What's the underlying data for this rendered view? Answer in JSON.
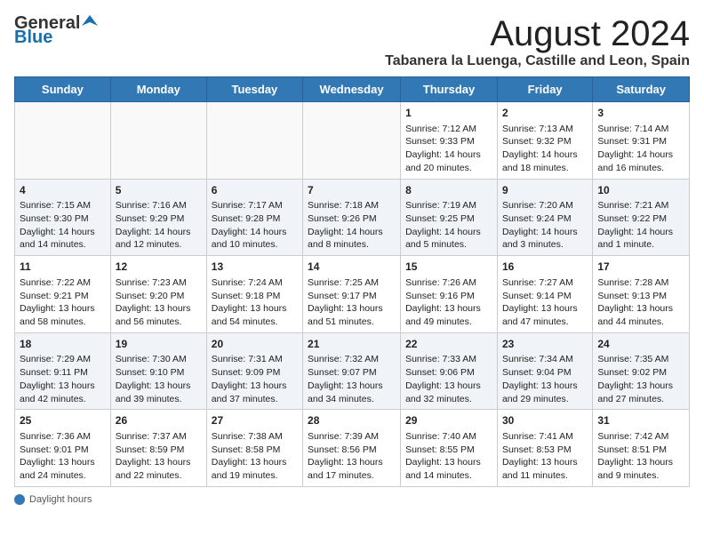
{
  "header": {
    "logo_general": "General",
    "logo_blue": "Blue",
    "title": "August 2024",
    "subtitle": "Tabanera la Luenga, Castille and Leon, Spain"
  },
  "weekdays": [
    "Sunday",
    "Monday",
    "Tuesday",
    "Wednesday",
    "Thursday",
    "Friday",
    "Saturday"
  ],
  "weeks": [
    [
      {
        "day": "",
        "info": ""
      },
      {
        "day": "",
        "info": ""
      },
      {
        "day": "",
        "info": ""
      },
      {
        "day": "",
        "info": ""
      },
      {
        "day": "1",
        "info": "Sunrise: 7:12 AM\nSunset: 9:33 PM\nDaylight: 14 hours and 20 minutes."
      },
      {
        "day": "2",
        "info": "Sunrise: 7:13 AM\nSunset: 9:32 PM\nDaylight: 14 hours and 18 minutes."
      },
      {
        "day": "3",
        "info": "Sunrise: 7:14 AM\nSunset: 9:31 PM\nDaylight: 14 hours and 16 minutes."
      }
    ],
    [
      {
        "day": "4",
        "info": "Sunrise: 7:15 AM\nSunset: 9:30 PM\nDaylight: 14 hours and 14 minutes."
      },
      {
        "day": "5",
        "info": "Sunrise: 7:16 AM\nSunset: 9:29 PM\nDaylight: 14 hours and 12 minutes."
      },
      {
        "day": "6",
        "info": "Sunrise: 7:17 AM\nSunset: 9:28 PM\nDaylight: 14 hours and 10 minutes."
      },
      {
        "day": "7",
        "info": "Sunrise: 7:18 AM\nSunset: 9:26 PM\nDaylight: 14 hours and 8 minutes."
      },
      {
        "day": "8",
        "info": "Sunrise: 7:19 AM\nSunset: 9:25 PM\nDaylight: 14 hours and 5 minutes."
      },
      {
        "day": "9",
        "info": "Sunrise: 7:20 AM\nSunset: 9:24 PM\nDaylight: 14 hours and 3 minutes."
      },
      {
        "day": "10",
        "info": "Sunrise: 7:21 AM\nSunset: 9:22 PM\nDaylight: 14 hours and 1 minute."
      }
    ],
    [
      {
        "day": "11",
        "info": "Sunrise: 7:22 AM\nSunset: 9:21 PM\nDaylight: 13 hours and 58 minutes."
      },
      {
        "day": "12",
        "info": "Sunrise: 7:23 AM\nSunset: 9:20 PM\nDaylight: 13 hours and 56 minutes."
      },
      {
        "day": "13",
        "info": "Sunrise: 7:24 AM\nSunset: 9:18 PM\nDaylight: 13 hours and 54 minutes."
      },
      {
        "day": "14",
        "info": "Sunrise: 7:25 AM\nSunset: 9:17 PM\nDaylight: 13 hours and 51 minutes."
      },
      {
        "day": "15",
        "info": "Sunrise: 7:26 AM\nSunset: 9:16 PM\nDaylight: 13 hours and 49 minutes."
      },
      {
        "day": "16",
        "info": "Sunrise: 7:27 AM\nSunset: 9:14 PM\nDaylight: 13 hours and 47 minutes."
      },
      {
        "day": "17",
        "info": "Sunrise: 7:28 AM\nSunset: 9:13 PM\nDaylight: 13 hours and 44 minutes."
      }
    ],
    [
      {
        "day": "18",
        "info": "Sunrise: 7:29 AM\nSunset: 9:11 PM\nDaylight: 13 hours and 42 minutes."
      },
      {
        "day": "19",
        "info": "Sunrise: 7:30 AM\nSunset: 9:10 PM\nDaylight: 13 hours and 39 minutes."
      },
      {
        "day": "20",
        "info": "Sunrise: 7:31 AM\nSunset: 9:09 PM\nDaylight: 13 hours and 37 minutes."
      },
      {
        "day": "21",
        "info": "Sunrise: 7:32 AM\nSunset: 9:07 PM\nDaylight: 13 hours and 34 minutes."
      },
      {
        "day": "22",
        "info": "Sunrise: 7:33 AM\nSunset: 9:06 PM\nDaylight: 13 hours and 32 minutes."
      },
      {
        "day": "23",
        "info": "Sunrise: 7:34 AM\nSunset: 9:04 PM\nDaylight: 13 hours and 29 minutes."
      },
      {
        "day": "24",
        "info": "Sunrise: 7:35 AM\nSunset: 9:02 PM\nDaylight: 13 hours and 27 minutes."
      }
    ],
    [
      {
        "day": "25",
        "info": "Sunrise: 7:36 AM\nSunset: 9:01 PM\nDaylight: 13 hours and 24 minutes."
      },
      {
        "day": "26",
        "info": "Sunrise: 7:37 AM\nSunset: 8:59 PM\nDaylight: 13 hours and 22 minutes."
      },
      {
        "day": "27",
        "info": "Sunrise: 7:38 AM\nSunset: 8:58 PM\nDaylight: 13 hours and 19 minutes."
      },
      {
        "day": "28",
        "info": "Sunrise: 7:39 AM\nSunset: 8:56 PM\nDaylight: 13 hours and 17 minutes."
      },
      {
        "day": "29",
        "info": "Sunrise: 7:40 AM\nSunset: 8:55 PM\nDaylight: 13 hours and 14 minutes."
      },
      {
        "day": "30",
        "info": "Sunrise: 7:41 AM\nSunset: 8:53 PM\nDaylight: 13 hours and 11 minutes."
      },
      {
        "day": "31",
        "info": "Sunrise: 7:42 AM\nSunset: 8:51 PM\nDaylight: 13 hours and 9 minutes."
      }
    ]
  ],
  "footer": {
    "daylight_label": "Daylight hours"
  },
  "colors": {
    "header_bg": "#3278b4",
    "accent": "#1a6fad"
  }
}
